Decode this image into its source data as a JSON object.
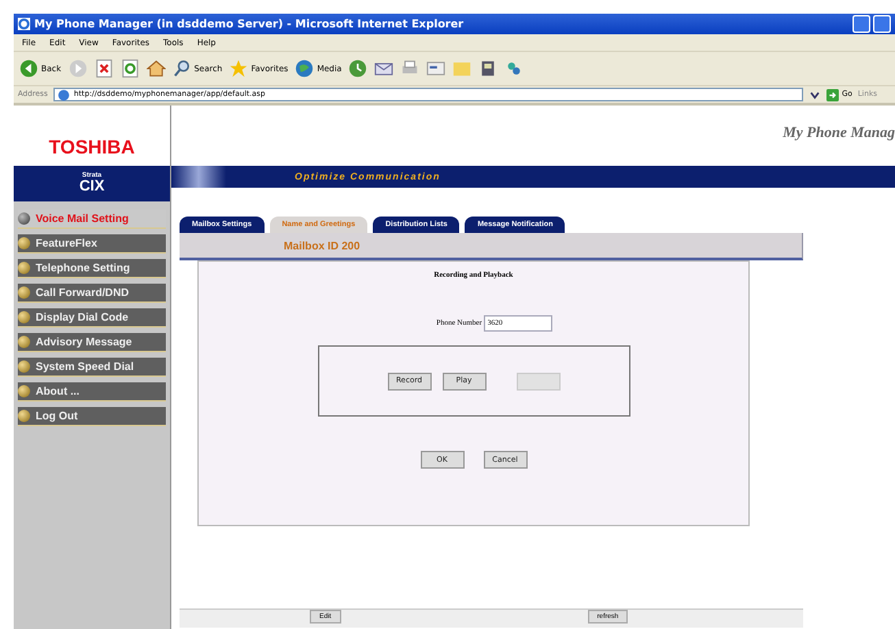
{
  "window": {
    "title": "My Phone Manager (in dsddemo Server) - Microsoft Internet Explorer"
  },
  "menu": [
    "File",
    "Edit",
    "View",
    "Favorites",
    "Tools",
    "Help"
  ],
  "toolbar": {
    "back": "Back",
    "search": "Search",
    "favorites": "Favorites",
    "media": "Media"
  },
  "address": {
    "label": "Address",
    "url": "http://dsddemo/myphonemanager/app/default.asp",
    "go": "Go",
    "links": "Links"
  },
  "header": {
    "logo": "TOSHIBA",
    "app_title": "My Phone Manag",
    "brand_small": "Strata",
    "brand": "CIX",
    "slogan": "Optimize Communication"
  },
  "sidebar": {
    "items": [
      {
        "label": "Voice Mail Setting",
        "selected": true
      },
      {
        "label": "FeatureFlex",
        "selected": false
      },
      {
        "label": "Telephone Setting",
        "selected": false
      },
      {
        "label": "Call Forward/DND",
        "selected": false
      },
      {
        "label": "Display Dial Code",
        "selected": false
      },
      {
        "label": "Advisory Message",
        "selected": false
      },
      {
        "label": "System Speed Dial",
        "selected": false
      },
      {
        "label": "About ...",
        "selected": false
      },
      {
        "label": "Log Out",
        "selected": false
      }
    ]
  },
  "tabs": [
    {
      "label": "Mailbox Settings",
      "selected": false
    },
    {
      "label": "Name and Greetings",
      "selected": true
    },
    {
      "label": "Distribution Lists",
      "selected": false
    },
    {
      "label": "Message Notification",
      "selected": false
    }
  ],
  "mailbox": "Mailbox ID 200",
  "form": {
    "heading": "Recording and Playback",
    "phone_label": "Phone Number",
    "phone_value": "3620",
    "playback_buttons": [
      {
        "label": "Record",
        "disabled": false
      },
      {
        "label": "Play",
        "disabled": false
      },
      {
        "disabled": true
      }
    ],
    "actions": [
      "OK",
      "Cancel"
    ]
  },
  "footer_buttons": [
    "Edit",
    "refresh"
  ]
}
